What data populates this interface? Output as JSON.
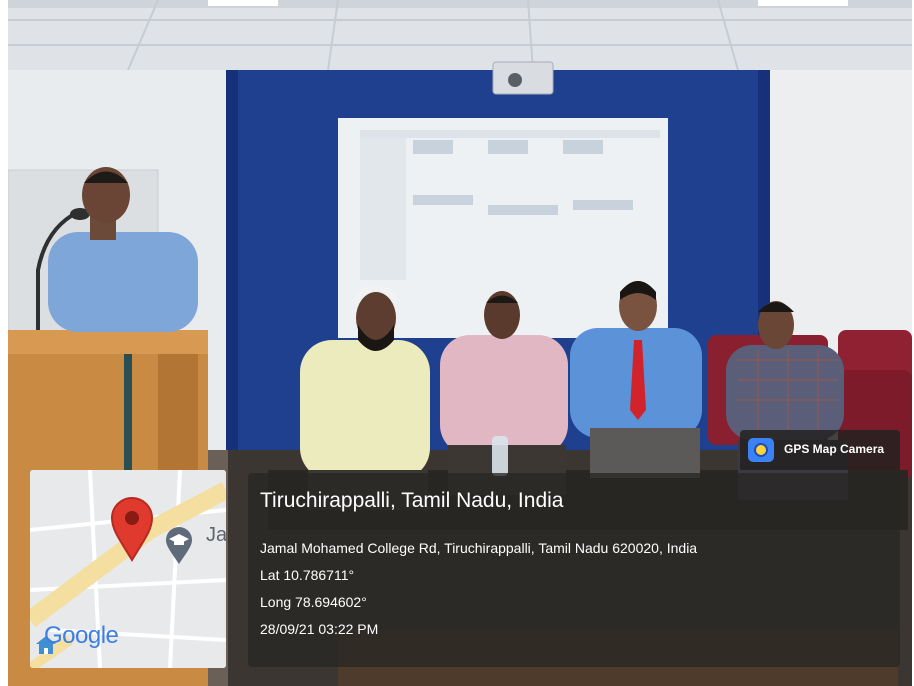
{
  "photo": {
    "description_alt": "Panel of five men at a seminar stage",
    "colors": {
      "wall": "#1f3f8f",
      "ceiling": "#dfe4ea",
      "screen": "#eef1f3",
      "podium": "#c98a44"
    }
  },
  "overlay": {
    "badge_label": "GPS Map Camera",
    "location_title": "Tiruchirappalli, Tamil Nadu, India",
    "address": "Jamal Mohamed College Rd, Tiruchirappalli, Tamil Nadu 620020, India",
    "lat": "Lat 10.786711°",
    "long": "Long 78.694602°",
    "datetime": "28/09/21 03:22 PM",
    "map_label": "Ja",
    "map_logo": "Google"
  },
  "icons": {
    "pin": "map-pin-icon",
    "graduation": "graduation-cap-icon",
    "camera_app": "gps-camera-app-icon"
  }
}
